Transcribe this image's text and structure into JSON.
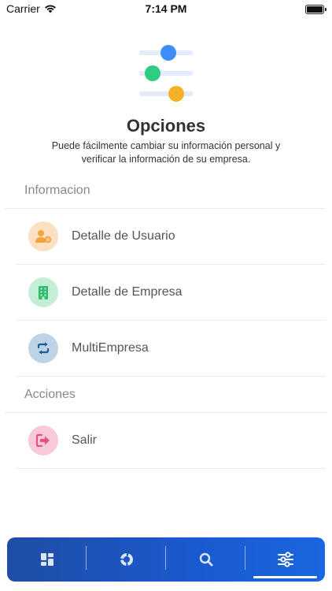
{
  "status_bar": {
    "carrier": "Carrier",
    "time": "7:14 PM"
  },
  "header": {
    "title": "Opciones",
    "subtitle": "Puede fácilmente cambiar su información personal y verificar la información de su empresa."
  },
  "sections": {
    "info": {
      "title": "Informacion",
      "items": [
        {
          "label": "Detalle de Usuario",
          "icon": "user-gear-icon",
          "icon_color": "#f2a33c",
          "icon_bg": "#fbe0c2"
        },
        {
          "label": "Detalle de Empresa",
          "icon": "building-icon",
          "icon_color": "#2fbe6e",
          "icon_bg": "#c6eed7"
        },
        {
          "label": "MultiEmpresa",
          "icon": "swap-arrows-icon",
          "icon_color": "#1d5e96",
          "icon_bg": "#bcd4e6"
        }
      ]
    },
    "actions": {
      "title": "Acciones",
      "items": [
        {
          "label": "Salir",
          "icon": "logout-icon",
          "icon_color": "#e94d84",
          "icon_bg": "#f9c9da"
        }
      ]
    }
  },
  "tab_bar": {
    "tabs": [
      {
        "icon": "dashboard-grid-icon",
        "active": false
      },
      {
        "icon": "donut-chart-icon",
        "active": false
      },
      {
        "icon": "search-icon",
        "active": false
      },
      {
        "icon": "sliders-icon",
        "active": true
      }
    ]
  },
  "colors": {
    "accent_blue": "#1a5ad0",
    "hero_blue": "#3e8ef7",
    "hero_green": "#2fcc86",
    "hero_orange": "#f7b02a",
    "hero_bar": "#e3ebfa"
  }
}
